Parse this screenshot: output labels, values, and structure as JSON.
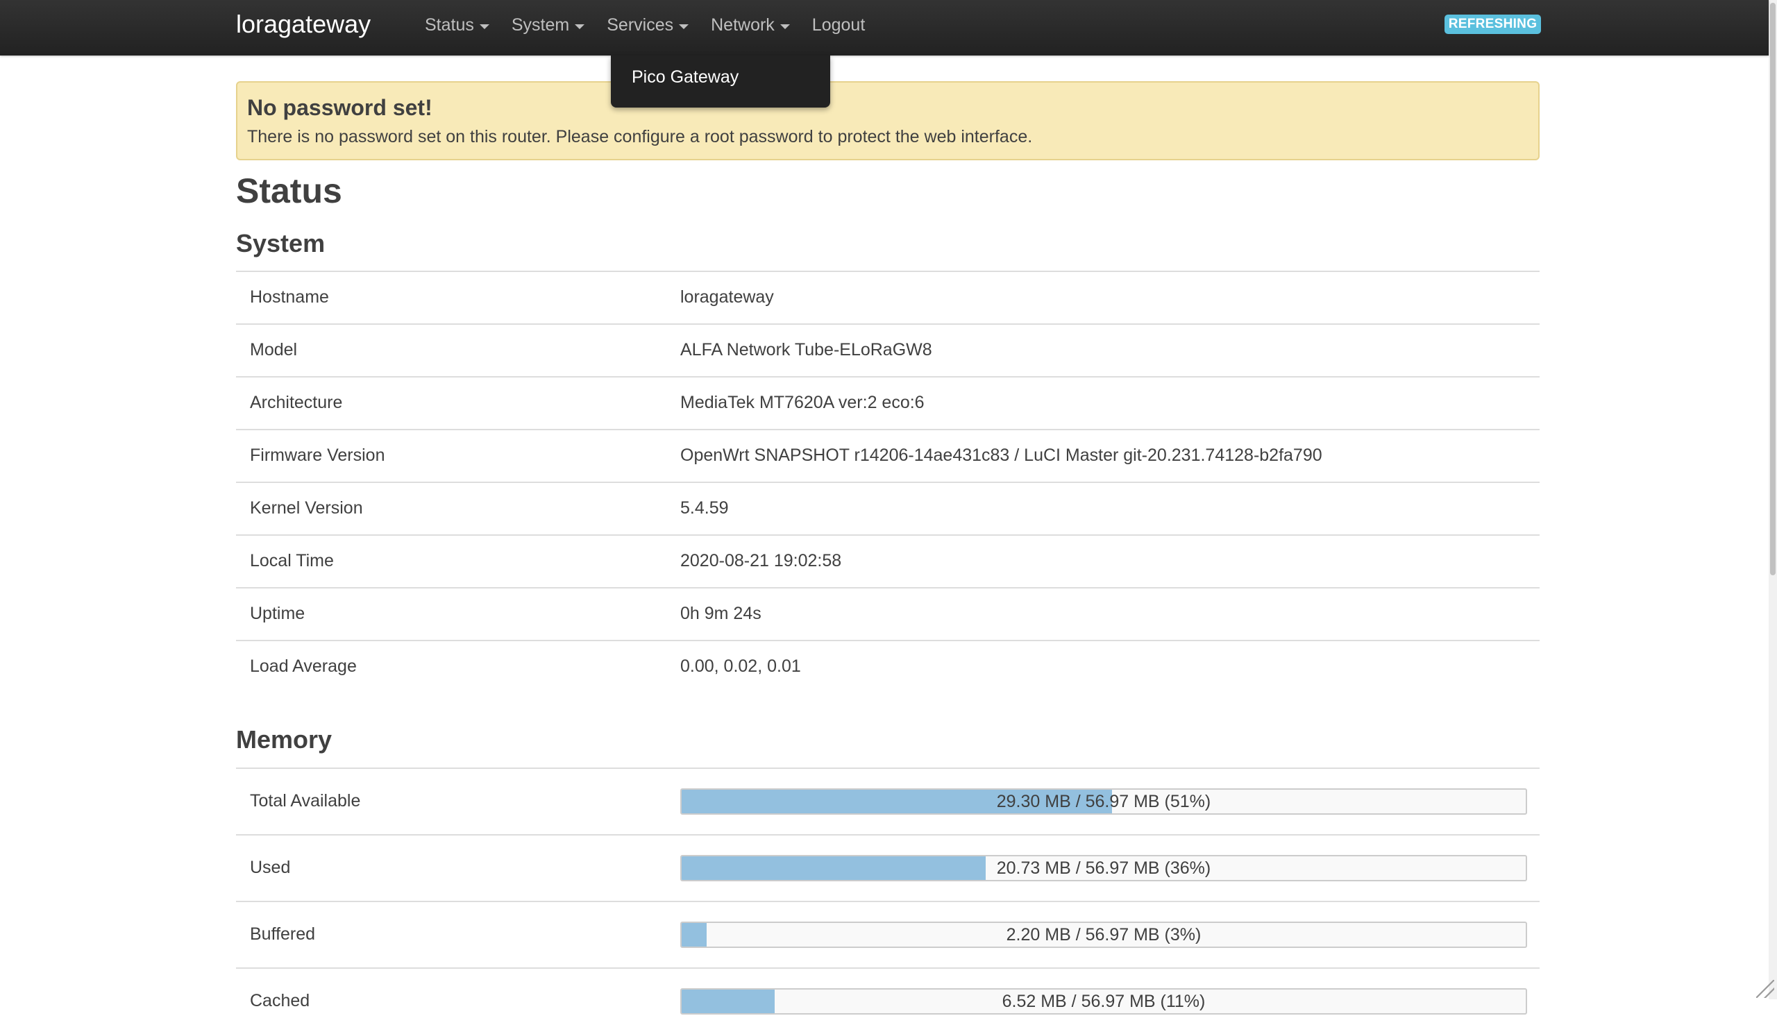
{
  "brand": "loragateway",
  "nav": [
    {
      "label": "Status",
      "has_caret": true
    },
    {
      "label": "System",
      "has_caret": true
    },
    {
      "label": "Services",
      "has_caret": true
    },
    {
      "label": "Network",
      "has_caret": true
    },
    {
      "label": "Logout",
      "has_caret": false
    }
  ],
  "refresh_badge": "REFRESHING",
  "services_dropdown": {
    "items": [
      "Pico Gateway"
    ]
  },
  "alert": {
    "title": "No password set!",
    "text": "There is no password set on this router. Please configure a root password to protect the web interface."
  },
  "page_title": "Status",
  "system": {
    "heading": "System",
    "rows": [
      {
        "label": "Hostname",
        "value": "loragateway"
      },
      {
        "label": "Model",
        "value": "ALFA Network Tube-ELoRaGW8"
      },
      {
        "label": "Architecture",
        "value": "MediaTek MT7620A ver:2 eco:6"
      },
      {
        "label": "Firmware Version",
        "value": "OpenWrt SNAPSHOT r14206-14ae431c83 / LuCI Master git-20.231.74128-b2fa790"
      },
      {
        "label": "Kernel Version",
        "value": "5.4.59"
      },
      {
        "label": "Local Time",
        "value": "2020-08-21 19:02:58"
      },
      {
        "label": "Uptime",
        "value": "0h 9m 24s"
      },
      {
        "label": "Load Average",
        "value": "0.00, 0.02, 0.01"
      }
    ]
  },
  "memory": {
    "heading": "Memory",
    "rows": [
      {
        "label": "Total Available",
        "text": "29.30 MB / 56.97 MB (51%)",
        "percent": 51
      },
      {
        "label": "Used",
        "text": "20.73 MB / 56.97 MB (36%)",
        "percent": 36
      },
      {
        "label": "Buffered",
        "text": "2.20 MB / 56.97 MB (3%)",
        "percent": 3
      },
      {
        "label": "Cached",
        "text": "6.52 MB / 56.97 MB (11%)",
        "percent": 11
      }
    ]
  },
  "colors": {
    "navbar": "#222222",
    "refresh_badge": "#5bc0de",
    "alert_bg": "#f8eab8",
    "progress_fill": "#93c0df"
  }
}
